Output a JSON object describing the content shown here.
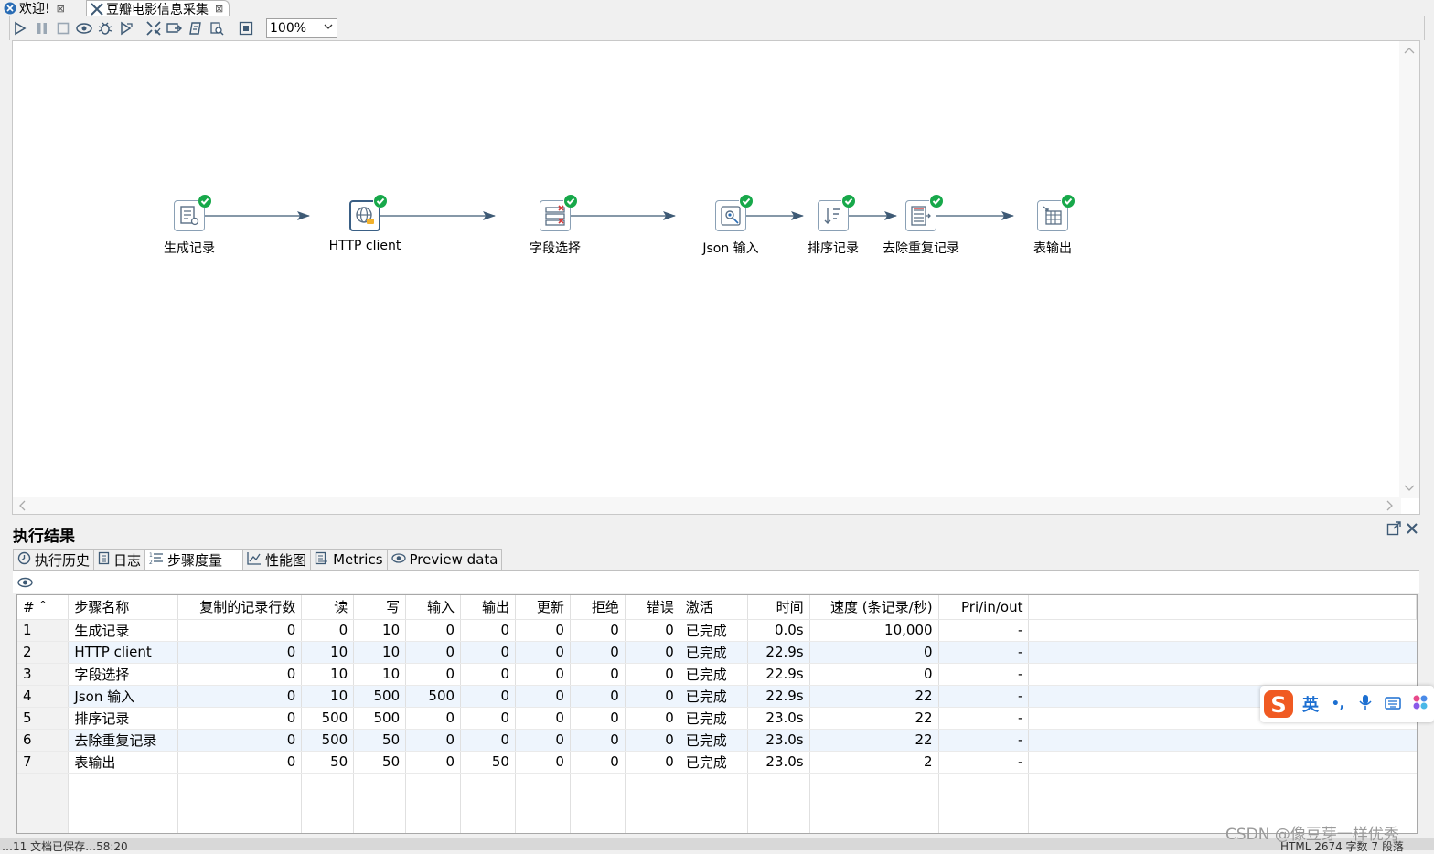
{
  "tabs": [
    {
      "label": "欢迎!",
      "icon": "spoon-icon",
      "close": "⊠"
    },
    {
      "label": "豆瓣电影信息采集",
      "icon": "transformation-icon",
      "close": "⊠"
    }
  ],
  "toolbar": {
    "buttons": [
      "run-icon",
      "pause-icon",
      "stop-icon",
      "preview-icon",
      "debug-icon",
      "replay-icon",
      "verify-icon",
      "impact-icon",
      "sql-icon",
      "explore-db-icon",
      "results-toggle-icon"
    ],
    "zoom": "100%"
  },
  "canvas": {
    "nodes": [
      {
        "label": "生成记录",
        "icon": "generate-rows-icon",
        "status": "success"
      },
      {
        "label": "HTTP client",
        "icon": "http-client-icon",
        "status": "success",
        "selected": true
      },
      {
        "label": "字段选择",
        "icon": "select-values-icon",
        "status": "success"
      },
      {
        "label": "Json 输入",
        "icon": "json-input-icon",
        "status": "success"
      },
      {
        "label": "排序记录",
        "icon": "sort-rows-icon",
        "status": "success"
      },
      {
        "label": "去除重复记录",
        "icon": "unique-rows-icon",
        "status": "success"
      },
      {
        "label": "表输出",
        "icon": "table-output-icon",
        "status": "success"
      }
    ]
  },
  "results": {
    "title": "执行结果",
    "tabs": [
      {
        "label": "执行历史",
        "icon": "history-icon"
      },
      {
        "label": "日志",
        "icon": "log-icon"
      },
      {
        "label": "步骤度量",
        "icon": "step-metrics-icon",
        "active": true
      },
      {
        "label": "性能图",
        "icon": "performance-graph-icon"
      },
      {
        "label": "Metrics",
        "icon": "metrics-icon"
      },
      {
        "label": "Preview data",
        "icon": "preview-eye-icon"
      }
    ],
    "columns": [
      "#",
      "步骤名称",
      "复制的记录行数",
      "读",
      "写",
      "输入",
      "输出",
      "更新",
      "拒绝",
      "错误",
      "激活",
      "时间",
      "速度 (条记录/秒)",
      "Pri/in/out"
    ],
    "rows": [
      [
        "1",
        "生成记录",
        "0",
        "0",
        "10",
        "0",
        "0",
        "0",
        "0",
        "0",
        "已完成",
        "0.0s",
        "10,000",
        "-"
      ],
      [
        "2",
        "HTTP client",
        "0",
        "10",
        "10",
        "0",
        "0",
        "0",
        "0",
        "0",
        "已完成",
        "22.9s",
        "0",
        "-"
      ],
      [
        "3",
        "字段选择",
        "0",
        "10",
        "10",
        "0",
        "0",
        "0",
        "0",
        "0",
        "已完成",
        "22.9s",
        "0",
        "-"
      ],
      [
        "4",
        "Json 输入",
        "0",
        "10",
        "500",
        "500",
        "0",
        "0",
        "0",
        "0",
        "已完成",
        "22.9s",
        "22",
        "-"
      ],
      [
        "5",
        "排序记录",
        "0",
        "500",
        "500",
        "0",
        "0",
        "0",
        "0",
        "0",
        "已完成",
        "23.0s",
        "22",
        "-"
      ],
      [
        "6",
        "去除重复记录",
        "0",
        "500",
        "50",
        "0",
        "0",
        "0",
        "0",
        "0",
        "已完成",
        "23.0s",
        "22",
        "-"
      ],
      [
        "7",
        "表输出",
        "0",
        "50",
        "50",
        "0",
        "50",
        "0",
        "0",
        "0",
        "已完成",
        "23.0s",
        "2",
        "-"
      ]
    ],
    "sort_indicator": "^"
  },
  "ime": {
    "mode": "英",
    "punct": "•,",
    "items": [
      "mic-icon",
      "keyboard-icon",
      "apps-icon"
    ]
  },
  "bottom": {
    "left": "…11  文档已保存…58:20",
    "right": "HTML  2674 字数  7 段落"
  },
  "watermark": "CSDN @像豆芽一样优秀",
  "colors": {
    "success": "#17a84a",
    "hop": "#3e5a75",
    "alt_row": "#eef5fd",
    "ime_s": "#f05a22",
    "ime_blue": "#1c6fd1"
  }
}
